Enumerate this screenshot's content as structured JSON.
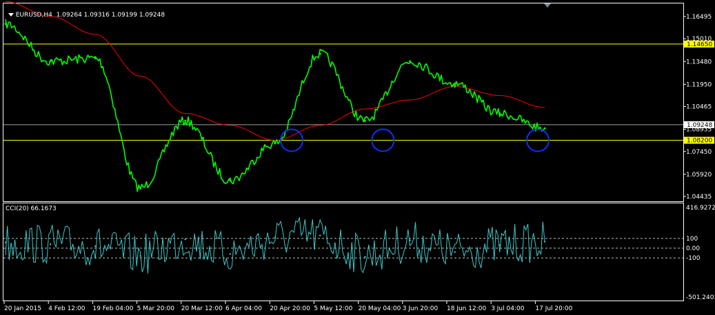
{
  "header": {
    "symbol": "EURUSD,H4",
    "ohlc": "1.09264 1.09316 1.09199 1.09248"
  },
  "indicator": {
    "title": "CCI(20) 66.1673"
  },
  "colors": {
    "background": "#000000",
    "price": "#00ff00",
    "moving_average": "#ff0000",
    "level_line": "#ffff00",
    "cci": "#40c8c8",
    "circle": "#1030ff",
    "frame": "#ffffff",
    "grid_dash": "#c0c0c0"
  },
  "chart_data": [
    {
      "type": "line",
      "title": "EURUSD,H4",
      "y_ticks": [
        "1.16495",
        "1.15010",
        "1.13480",
        "1.11950",
        "1.10465",
        "1.08935",
        "1.07450",
        "1.05920",
        "1.04435"
      ],
      "ylim": [
        1.04435,
        1.16495
      ],
      "current_price_label": "1.09248",
      "horizontal_levels": [
        {
          "value": 1.1465,
          "label": "1.14650"
        },
        {
          "value": 1.082,
          "label": "1.08200"
        }
      ],
      "x_ticks": [
        "20 Jan 2015",
        "4 Feb 12:00",
        "19 Feb 04:00",
        "5 Mar 20:00",
        "20 Mar 12:00",
        "6 Apr 04:00",
        "20 Apr 20:00",
        "5 May 12:00",
        "20 May 04:00",
        "3 Jun 20:00",
        "18 Jun 12:00",
        "3 Jul 04:00",
        "17 Jul 20:00"
      ],
      "series": [
        {
          "type": "line",
          "values": [
            {
              "x": "20 Jan 2015",
              "y": 1.16
            },
            {
              "x": "4 Feb 12:00",
              "y": 1.135
            },
            {
              "x": "19 Feb 04:00",
              "y": 1.137
            },
            {
              "x": "5 Mar 20:00",
              "y": 1.05
            },
            {
              "x": "20 Mar 12:00",
              "y": 1.095
            },
            {
              "x": "6 Apr 04:00",
              "y": 1.055
            },
            {
              "x": "20 Apr 20:00",
              "y": 1.08
            },
            {
              "x": "5 May 12:00",
              "y": 1.14
            },
            {
              "x": "20 May 04:00",
              "y": 1.095
            },
            {
              "x": "3 Jun 20:00",
              "y": 1.135
            },
            {
              "x": "18 Jun 12:00",
              "y": 1.12
            },
            {
              "x": "3 Jul 04:00",
              "y": 1.1
            },
            {
              "x": "17 Jul 20:00",
              "y": 1.09
            }
          ]
        },
        {
          "type": "line",
          "values": [
            {
              "x": "20 Jan 2015",
              "y": 1.175
            },
            {
              "x": "4 Feb 12:00",
              "y": 1.165
            },
            {
              "x": "19 Feb 04:00",
              "y": 1.153
            },
            {
              "x": "5 Mar 20:00",
              "y": 1.125
            },
            {
              "x": "20 Mar 12:00",
              "y": 1.1
            },
            {
              "x": "6 Apr 04:00",
              "y": 1.092
            },
            {
              "x": "20 Apr 20:00",
              "y": 1.082
            },
            {
              "x": "5 May 12:00",
              "y": 1.092
            },
            {
              "x": "20 May 04:00",
              "y": 1.103
            },
            {
              "x": "3 Jun 20:00",
              "y": 1.109
            },
            {
              "x": "18 Jun 12:00",
              "y": 1.118
            },
            {
              "x": "3 Jul 04:00",
              "y": 1.112
            },
            {
              "x": "17 Jul 20:00",
              "y": 1.104
            }
          ]
        }
      ]
    },
    {
      "type": "line",
      "title": "CCI(20) 66.1673",
      "y_ticks": [
        "416.9272",
        "100",
        "0.00",
        "-100",
        "-501.2403"
      ],
      "ylim": [
        -501.2403,
        416.9272
      ],
      "levels": [
        100,
        0,
        -100
      ],
      "series": [
        {
          "type": "line",
          "values": [
            {
              "x": "20 Jan 2015",
              "y": 60
            },
            {
              "x": "4 Feb 12:00",
              "y": 40
            },
            {
              "x": "19 Feb 04:00",
              "y": 20
            },
            {
              "x": "5 Mar 20:00",
              "y": -80
            },
            {
              "x": "20 Mar 12:00",
              "y": 90
            },
            {
              "x": "6 Apr 04:00",
              "y": -60
            },
            {
              "x": "20 Apr 20:00",
              "y": 110
            },
            {
              "x": "5 May 12:00",
              "y": 130
            },
            {
              "x": "20 May 04:00",
              "y": -90
            },
            {
              "x": "3 Jun 20:00",
              "y": 80
            },
            {
              "x": "18 Jun 12:00",
              "y": -40
            },
            {
              "x": "3 Jul 04:00",
              "y": 30
            },
            {
              "x": "17 Jul 20:00",
              "y": 66.1673
            }
          ]
        }
      ]
    }
  ]
}
